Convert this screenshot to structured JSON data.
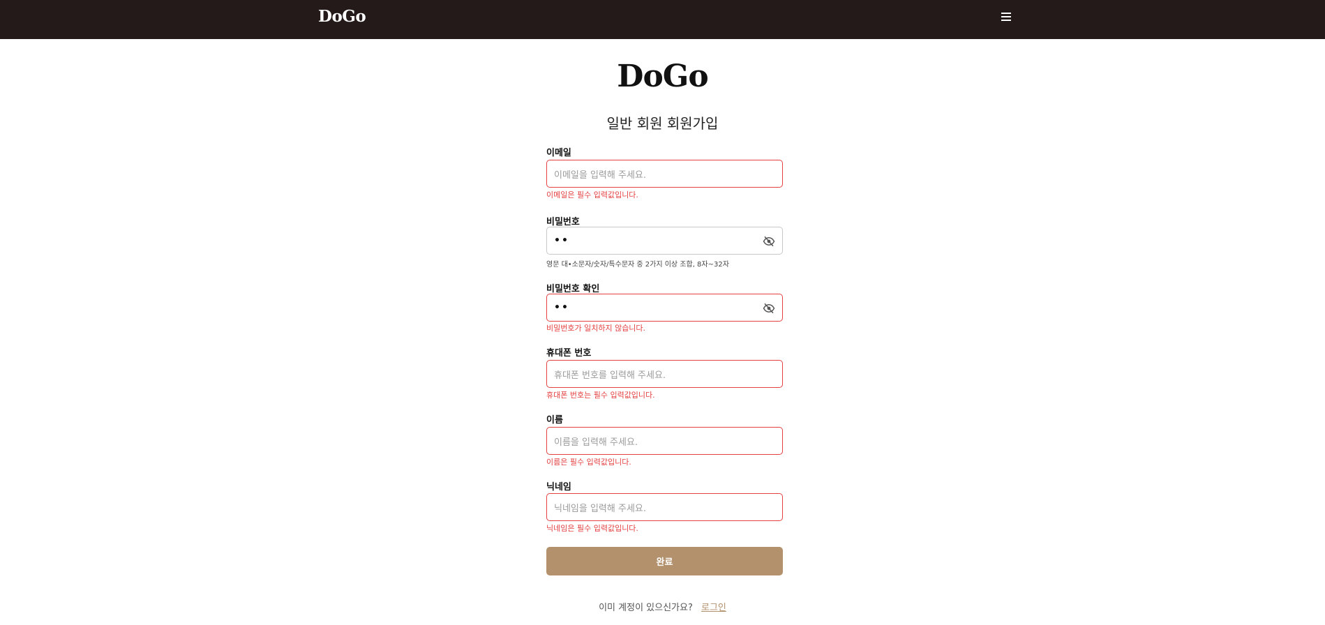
{
  "header": {
    "brand": "DoGo"
  },
  "logo": "DoGo",
  "title": "일반 회원 회원가입",
  "fields": {
    "email": {
      "label": "이메일",
      "placeholder": "이메일을 입력해 주세요.",
      "error": "이메일은 필수 입력값입니다."
    },
    "password": {
      "label": "비밀번호",
      "value": "••",
      "helper": "영문 대•소문자/숫자/특수문자 중 2가지 이상 조합, 8자~32자"
    },
    "password_confirm": {
      "label": "비밀번호 확인",
      "value": "••",
      "error": "비밀번호가 일치하지 않습니다."
    },
    "phone": {
      "label": "휴대폰 번호",
      "placeholder": "휴대폰 번호를 입력해 주세요.",
      "error": "휴대폰 번호는 필수 입력값입니다."
    },
    "name": {
      "label": "이름",
      "placeholder": "이름을 입력해 주세요.",
      "error": "이름은 필수 입력값입니다."
    },
    "nickname": {
      "label": "닉네임",
      "placeholder": "닉네임을 입력해 주세요.",
      "error": "닉네임은 필수 입력값입니다."
    }
  },
  "submit_label": "완료",
  "login_prompt": "이미 계정이 있으신가요?",
  "login_link": "로그인",
  "icons": {
    "menu": "hamburger-menu-icon",
    "password_toggle": "eye-off-icon"
  },
  "colors": {
    "header_bg": "#231a19",
    "accent": "#b3916d",
    "error": "#e53f3f"
  }
}
